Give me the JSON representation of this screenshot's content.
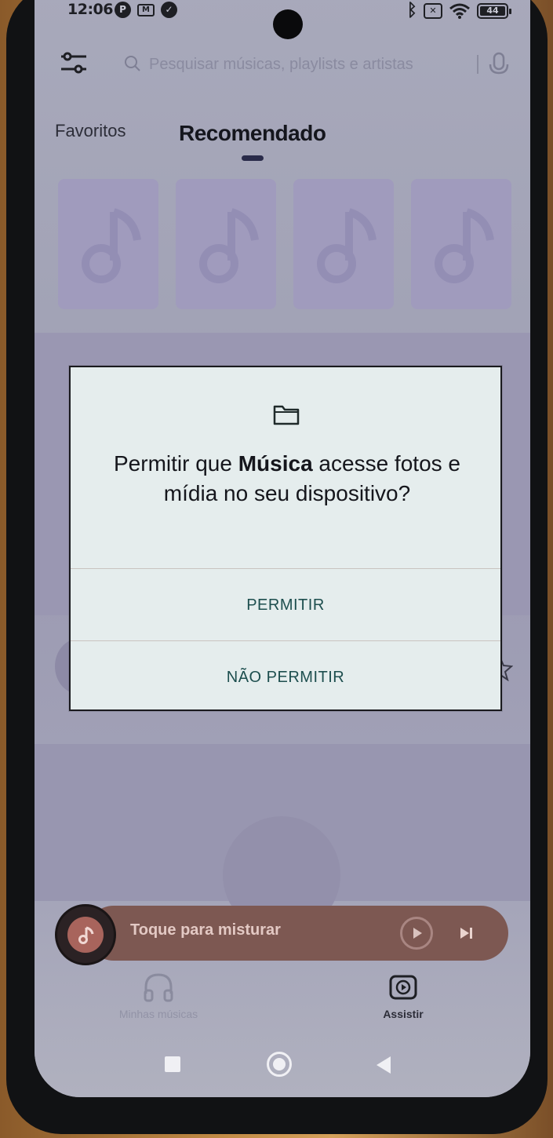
{
  "status_bar": {
    "time": "12:06",
    "left_icons": [
      "notification-p-icon",
      "gmail-icon",
      "check-circle-icon"
    ],
    "right_icons": [
      "bluetooth-icon",
      "no-sim-icon",
      "wifi-icon",
      "battery-icon"
    ],
    "battery_level": "44"
  },
  "top_bar": {
    "search_placeholder": "Pesquisar músicas, playlists e artistas"
  },
  "tabs": [
    {
      "label": "Favoritos",
      "active": false
    },
    {
      "label": "Recomendado",
      "active": true
    }
  ],
  "mini_player": {
    "label": "Toque para misturar"
  },
  "bottom_nav": {
    "items": [
      {
        "label": "Minhas músicas",
        "icon": "headphones-icon",
        "active": false
      },
      {
        "label": "Assistir",
        "icon": "play-square-icon",
        "active": true
      }
    ]
  },
  "dialog": {
    "icon": "folder-icon",
    "title_prefix": "Permitir que ",
    "title_app": "Música",
    "title_suffix": " acesse fotos e mídia no seu dispositivo?",
    "allow_label": "PERMITIR",
    "deny_label": "NÃO PERMITIR"
  },
  "colors": {
    "dialog_button_text": "#1d4e4e",
    "mini_player_bg": "#7d5852",
    "overlay_tint": "#a6a7ba"
  }
}
